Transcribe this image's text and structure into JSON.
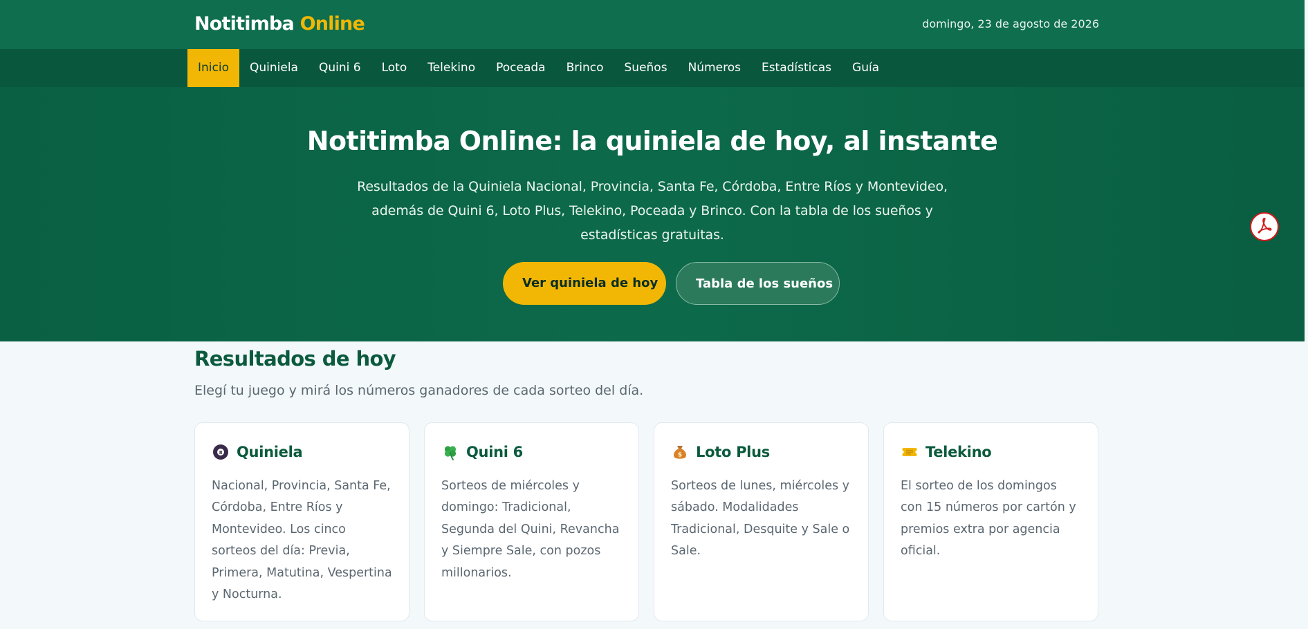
{
  "header": {
    "brand_main": "Notitimba",
    "brand_accent": "Online",
    "date": "domingo, 23 de agosto de 2026"
  },
  "nav": {
    "items": [
      {
        "label": "Inicio",
        "active": true
      },
      {
        "label": "Quiniela"
      },
      {
        "label": "Quini 6"
      },
      {
        "label": "Loto"
      },
      {
        "label": "Telekino"
      },
      {
        "label": "Poceada"
      },
      {
        "label": "Brinco"
      },
      {
        "label": "Sueños"
      },
      {
        "label": "Números"
      },
      {
        "label": "Estadísticas"
      },
      {
        "label": "Guía"
      }
    ]
  },
  "hero": {
    "title": "Notitimba Online: la quiniela de hoy, al instante",
    "subtitle": "Resultados de la Quiniela Nacional, Provincia, Santa Fe, Córdoba, Entre Ríos y Montevideo, además de Quini 6, Loto Plus, Telekino, Poceada y Brinco. Con la tabla de los sueños y estadísticas gratuitas.",
    "primary_button": "Ver quiniela de hoy",
    "secondary_button": "Tabla de los sueños"
  },
  "floating": {
    "icon": "pdf-icon",
    "color": "#d11a1a"
  },
  "results": {
    "title": "Resultados de hoy",
    "subtitle": "Elegí tu juego y mirá los números ganadores de cada sorteo del día.",
    "cards": [
      {
        "icon": "billiard-ball-icon",
        "title": "Quiniela",
        "text": "Nacional, Provincia, Santa Fe, Córdoba, Entre Ríos y Montevideo. Los cinco sorteos del día: Previa, Primera, Matutina, Vespertina y Nocturna."
      },
      {
        "icon": "clover-icon",
        "title": "Quini 6",
        "text": "Sorteos de miércoles y domingo: Tradicional, Segunda del Quini, Revancha y Siempre Sale, con pozos millonarios."
      },
      {
        "icon": "money-bag-icon",
        "title": "Loto Plus",
        "text": "Sorteos de lunes, miércoles y sábado. Modalidades Tradicional, Desquite y Sale o Sale."
      },
      {
        "icon": "ticket-icon",
        "title": "Telekino",
        "text": "El sorteo de los domingos con 15 números por cartón y premios extra por agencia oficial."
      }
    ]
  },
  "colors": {
    "brand_green": "#0e6e4d",
    "nav_green": "#09573d",
    "accent_yellow": "#f2b705",
    "heading_green": "#0b5a3e",
    "page_background": "#f3f8fa"
  }
}
